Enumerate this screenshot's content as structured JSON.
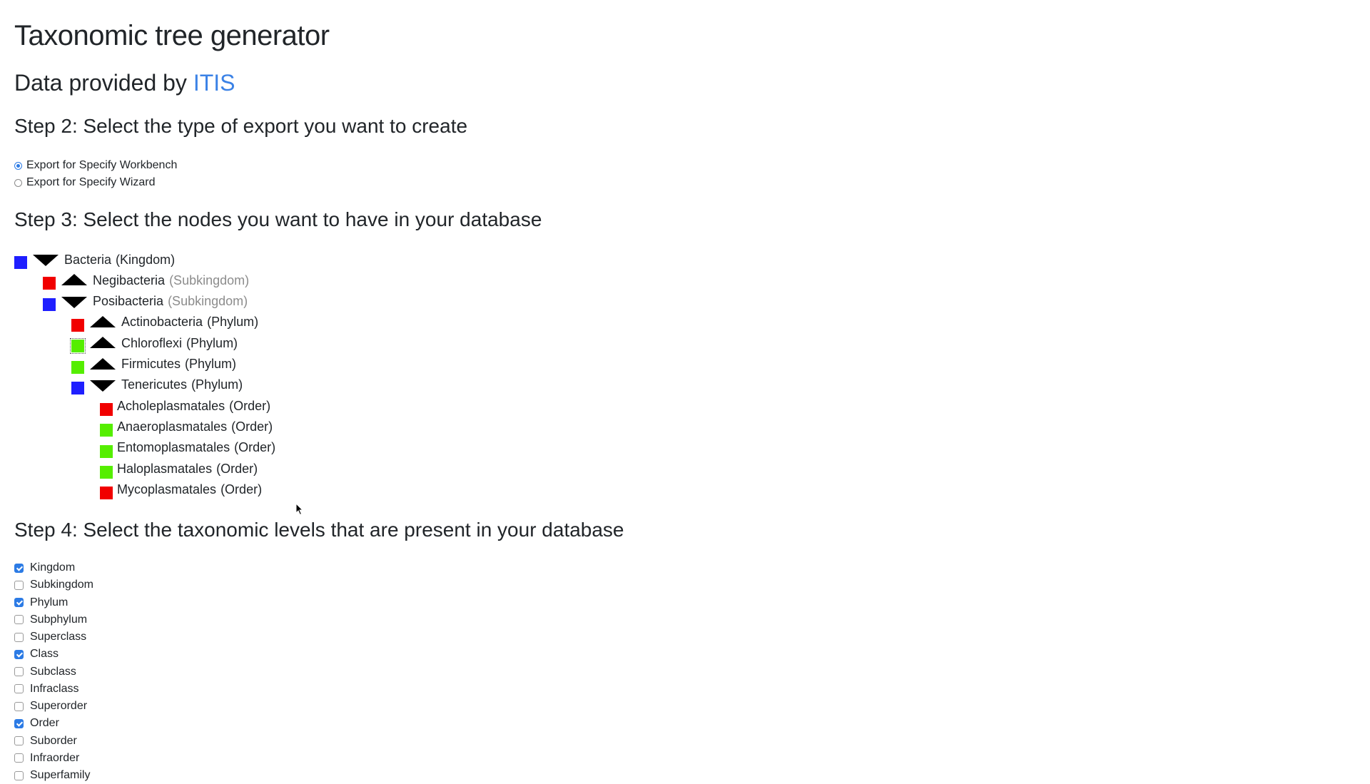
{
  "title": "Taxonomic tree generator",
  "provided": {
    "prefix": "Data provided by",
    "link": "ITIS",
    "link_color": "#3b82e6"
  },
  "step2": {
    "heading": "Step 2: Select the type of export you want to create",
    "options": [
      {
        "label": "Export for Specify Workbench",
        "checked": true
      },
      {
        "label": "Export for Specify Wizard",
        "checked": false
      }
    ]
  },
  "step3": {
    "heading": "Step 3: Select the nodes you want to have in your database",
    "nodes": [
      {
        "name": "Bacteria",
        "rank": "(Kingdom)",
        "state": "blue",
        "arrow": "down",
        "depth": 0
      },
      {
        "name": "Negibacteria",
        "rank": "(Subkingdom)",
        "state": "red",
        "arrow": "up",
        "depth": 1,
        "rank_muted": true
      },
      {
        "name": "Posibacteria",
        "rank": "(Subkingdom)",
        "state": "blue",
        "arrow": "down",
        "depth": 1,
        "rank_muted": true
      },
      {
        "name": "Actinobacteria",
        "rank": "(Phylum)",
        "state": "red",
        "arrow": "up",
        "depth": 2
      },
      {
        "name": "Chloroflexi",
        "rank": "(Phylum)",
        "state": "green",
        "arrow": "up",
        "depth": 2
      },
      {
        "name": "Firmicutes",
        "rank": "(Phylum)",
        "state": "green",
        "arrow": "up",
        "depth": 2
      },
      {
        "name": "Tenericutes",
        "rank": "(Phylum)",
        "state": "blue",
        "arrow": "down",
        "depth": 2
      },
      {
        "name": "Acholeplasmatales",
        "rank": "(Order)",
        "state": "red",
        "arrow": "none",
        "depth": 3
      },
      {
        "name": "Anaeroplasmatales",
        "rank": "(Order)",
        "state": "green",
        "arrow": "none",
        "depth": 3
      },
      {
        "name": "Entomoplasmatales",
        "rank": "(Order)",
        "state": "green",
        "arrow": "none",
        "depth": 3
      },
      {
        "name": "Haloplasmatales",
        "rank": "(Order)",
        "state": "green",
        "arrow": "none",
        "depth": 3
      },
      {
        "name": "Mycoplasmatales",
        "rank": "(Order)",
        "state": "red",
        "arrow": "none",
        "depth": 3
      }
    ],
    "colors": {
      "blue": "#1f1fff",
      "red": "#f10000",
      "green": "#55ee00"
    }
  },
  "step4": {
    "heading": "Step 4: Select the taxonomic levels that are present in your database",
    "levels": [
      {
        "label": "Kingdom",
        "checked": true
      },
      {
        "label": "Subkingdom",
        "checked": false
      },
      {
        "label": "Phylum",
        "checked": true
      },
      {
        "label": "Subphylum",
        "checked": false
      },
      {
        "label": "Superclass",
        "checked": false
      },
      {
        "label": "Class",
        "checked": true
      },
      {
        "label": "Subclass",
        "checked": false
      },
      {
        "label": "Infraclass",
        "checked": false
      },
      {
        "label": "Superorder",
        "checked": false
      },
      {
        "label": "Order",
        "checked": true
      },
      {
        "label": "Suborder",
        "checked": false
      },
      {
        "label": "Infraorder",
        "checked": false
      },
      {
        "label": "Superfamily",
        "checked": false
      }
    ]
  }
}
